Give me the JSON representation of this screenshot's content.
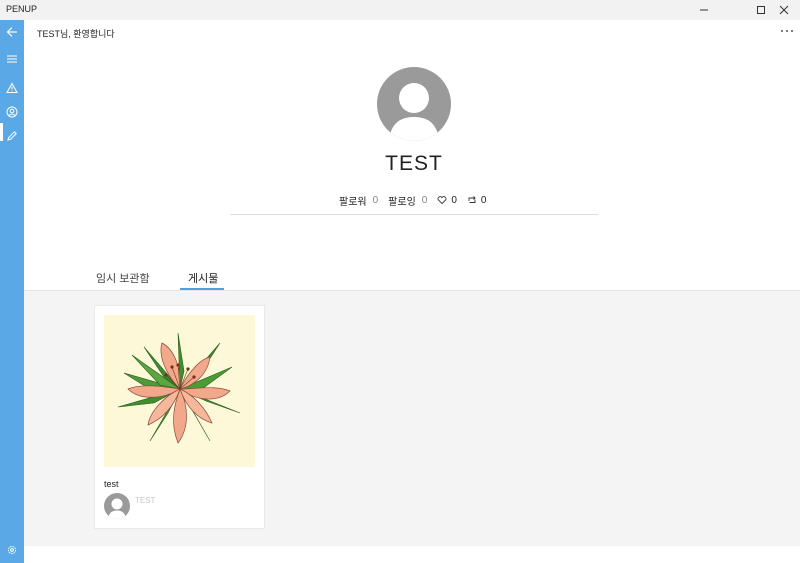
{
  "window": {
    "app_title": "PENUP"
  },
  "header": {
    "title": "TEST님, 환영합니다"
  },
  "profile": {
    "username": "TEST",
    "followers_label": "팔로워",
    "followers_count": "0",
    "following_label": "팔로잉",
    "following_count": "0",
    "likes_count": "0",
    "reposts_count": "0"
  },
  "tabs": [
    {
      "label": "임시 보관함",
      "selected": false
    },
    {
      "label": "게시물",
      "selected": true
    }
  ],
  "posts": [
    {
      "title": "test",
      "author": "TEST",
      "image": "lily-flower-drawing"
    }
  ],
  "sidebar": {
    "items": [
      {
        "icon": "back-arrow-icon"
      },
      {
        "icon": "hamburger-menu-icon"
      },
      {
        "icon": "alert-triangle-icon"
      },
      {
        "icon": "user-circle-icon",
        "selected": true
      },
      {
        "icon": "pencil-icon"
      },
      {
        "icon": "gear-icon"
      }
    ]
  },
  "colors": {
    "sidebar": "#5aa9e6",
    "tab_accent": "#4aa3df",
    "avatar": "#9a9a9a",
    "content_bg": "#f4f4f4"
  }
}
